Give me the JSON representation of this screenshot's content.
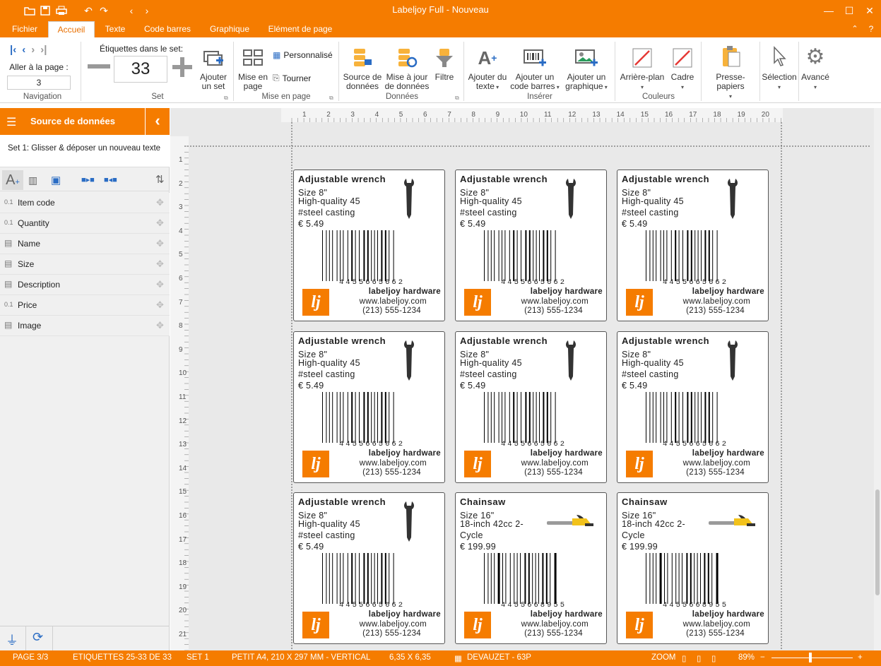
{
  "app": {
    "title": "Labeljoy Full - Nouveau"
  },
  "tabs": [
    "Fichier",
    "Accueil",
    "Texte",
    "Code barres",
    "Graphique",
    "Elément de page"
  ],
  "ribbon": {
    "navigation": {
      "goto_label": "Aller à la page :",
      "page_value": "3",
      "group": "Navigation"
    },
    "set": {
      "labels_caption": "Étiquettes dans le set:",
      "count": "33",
      "add_set": "Ajouter un set",
      "group": "Set"
    },
    "layout": {
      "mise_en_page": "Mise en page",
      "personnalise": "Personnalisé",
      "tourner": "Tourner",
      "group": "Mise en page"
    },
    "data": {
      "source": "Source de données",
      "update": "Mise à jour de données",
      "filter": "Filtre",
      "group": "Données"
    },
    "insert": {
      "add_text": "Ajouter du texte",
      "add_barcode": "Ajouter un code barres",
      "add_graphic": "Ajouter un graphique",
      "group": "Insérer"
    },
    "colors": {
      "background": "Arrière-plan",
      "frame": "Cadre",
      "group": "Couleurs"
    },
    "clipboard": "Presse-papiers",
    "selection": "Sélection",
    "advanced": "Avancé"
  },
  "sidebar": {
    "title": "Source de données",
    "subtitle": "Set 1: Glisser & déposer un nouveau texte",
    "fields": [
      {
        "type": "0.1",
        "label": "Item code"
      },
      {
        "type": "0.1",
        "label": "Quantity"
      },
      {
        "type": "txt",
        "label": "Name"
      },
      {
        "type": "txt",
        "label": "Size"
      },
      {
        "type": "txt",
        "label": "Description"
      },
      {
        "type": "0.1",
        "label": "Price"
      },
      {
        "type": "txt",
        "label": "Image"
      }
    ]
  },
  "ruler": {
    "top": [
      "1",
      "2",
      "3",
      "4",
      "5",
      "6",
      "7",
      "8",
      "9",
      "10",
      "11",
      "12",
      "13",
      "14",
      "15",
      "16",
      "17",
      "18",
      "19",
      "20"
    ],
    "left": [
      "1",
      "2",
      "3",
      "4",
      "5",
      "6",
      "7",
      "8",
      "9",
      "10",
      "11",
      "12",
      "13",
      "14",
      "15",
      "16",
      "17",
      "18",
      "19",
      "20",
      "21"
    ]
  },
  "labels": [
    {
      "name": "Adjustable wrench",
      "line1": "Size 8\"",
      "line2": "High-quality 45",
      "line3": "#steel casting",
      "line4": "€ 5.49",
      "code": "4455665662",
      "company": "labeljoy hardware",
      "web": "www.labeljoy.com",
      "phone": "(213) 555-1234",
      "pic": "wrench-icon"
    },
    {
      "name": "Adjustable wrench",
      "line1": "Size 8\"",
      "line2": "High-quality 45",
      "line3": "#steel casting",
      "line4": "€ 5.49",
      "code": "4455665662",
      "company": "labeljoy hardware",
      "web": "www.labeljoy.com",
      "phone": "(213) 555-1234",
      "pic": "wrench-icon"
    },
    {
      "name": "Adjustable wrench",
      "line1": "Size 8\"",
      "line2": "High-quality 45",
      "line3": "#steel casting",
      "line4": "€ 5.49",
      "code": "4455665662",
      "company": "labeljoy hardware",
      "web": "www.labeljoy.com",
      "phone": "(213) 555-1234",
      "pic": "wrench-icon"
    },
    {
      "name": "Adjustable wrench",
      "line1": "Size 8\"",
      "line2": "High-quality 45",
      "line3": "#steel casting",
      "line4": "€ 5.49",
      "code": "4455665662",
      "company": "labeljoy hardware",
      "web": "www.labeljoy.com",
      "phone": "(213) 555-1234",
      "pic": "wrench-icon"
    },
    {
      "name": "Adjustable wrench",
      "line1": "Size 8\"",
      "line2": "High-quality 45",
      "line3": "#steel casting",
      "line4": "€ 5.49",
      "code": "4455665662",
      "company": "labeljoy hardware",
      "web": "www.labeljoy.com",
      "phone": "(213) 555-1234",
      "pic": "wrench-icon"
    },
    {
      "name": "Adjustable wrench",
      "line1": "Size 8\"",
      "line2": "High-quality 45",
      "line3": "#steel casting",
      "line4": "€ 5.49",
      "code": "4455665662",
      "company": "labeljoy hardware",
      "web": "www.labeljoy.com",
      "phone": "(213) 555-1234",
      "pic": "wrench-icon"
    },
    {
      "name": "Adjustable wrench",
      "line1": "Size 8\"",
      "line2": "High-quality 45",
      "line3": "#steel casting",
      "line4": "€ 5.49",
      "code": "4455665662",
      "company": "labeljoy hardware",
      "web": "www.labeljoy.com",
      "phone": "(213) 555-1234",
      "pic": "wrench-icon"
    },
    {
      "name": "Chainsaw",
      "line1": "Size 16\"",
      "line2": "18-inch 42cc 2-",
      "line3": "Cycle",
      "line4": "€ 199.99",
      "code": "4455668955",
      "company": "labeljoy hardware",
      "web": "www.labeljoy.com",
      "phone": "(213) 555-1234",
      "pic": "chainsaw-icon"
    },
    {
      "name": "Chainsaw",
      "line1": "Size 16\"",
      "line2": "18-inch 42cc 2-",
      "line3": "Cycle",
      "line4": "€ 199.99",
      "code": "4455668955",
      "company": "labeljoy hardware",
      "web": "www.labeljoy.com",
      "phone": "(213) 555-1234",
      "pic": "chainsaw-icon"
    }
  ],
  "logo_text": "lj",
  "status": {
    "page": "PAGE 3/3",
    "labels": "ETIQUETTES 25-33 DE 33",
    "set": "SET 1",
    "paper": "PETIT A4, 210 X 297 MM - VERTICAL",
    "size": "6,35 X 6,35",
    "template": "DEVAUZET - 63P",
    "zoom_label": "ZOOM",
    "zoom_value": "89%"
  },
  "colors": {
    "accent": "#f57c00",
    "canvas": "#e9e9e9"
  }
}
